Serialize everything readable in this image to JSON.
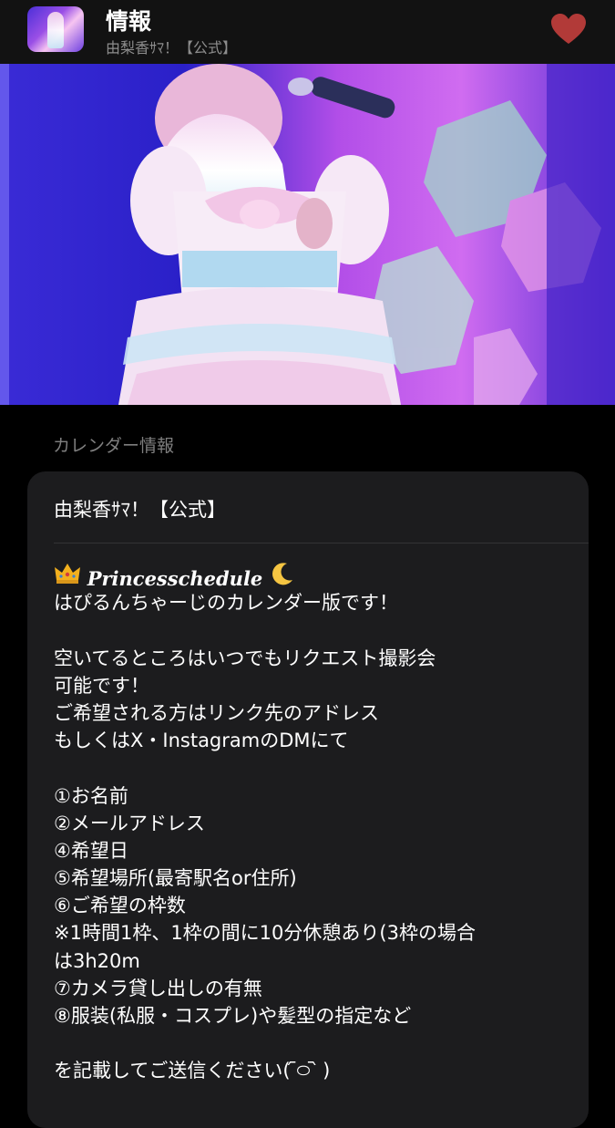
{
  "header": {
    "title": "情報",
    "subtitle": "由梨香ｻﾏ！【公式】",
    "favorite_icon": "heart-icon",
    "favorite_color": "#b23a38",
    "app_icon": "app-avatar-icon"
  },
  "section": {
    "label": "カレンダー情報"
  },
  "card": {
    "title": "由梨香ｻﾏ！【公式】",
    "headline_prefix_icon": "crown-icon",
    "headline": "Princesschedule",
    "headline_suffix_icon": "moon-icon",
    "lines": [
      "はぴるんちゃーじのカレンダー版です！",
      "",
      "空いてるところはいつでもリクエスト撮影会",
      "可能です！",
      "ご希望される方はリンク先のアドレス",
      "もしくはX・InstagramのDMにて",
      "",
      "①お名前",
      "②メールアドレス",
      "④希望日",
      "⑤希望場所(最寄駅名or住所)",
      "⑥ご希望の枠数",
      "※1時間1枠、1枠の間に10分休憩あり(3枠の場合",
      "は3h20m",
      "⑦カメラ貸し出しの有無",
      "⑧服装(私服・コスプレ)や髪型の指定など",
      "",
      "を記載してご送信ください‎(  ᷇࿀ ᷆ )"
    ]
  },
  "colors": {
    "background": "#000000",
    "header_bg": "#121212",
    "card_bg": "#1c1c1e",
    "muted_text": "#8d8d8d"
  }
}
